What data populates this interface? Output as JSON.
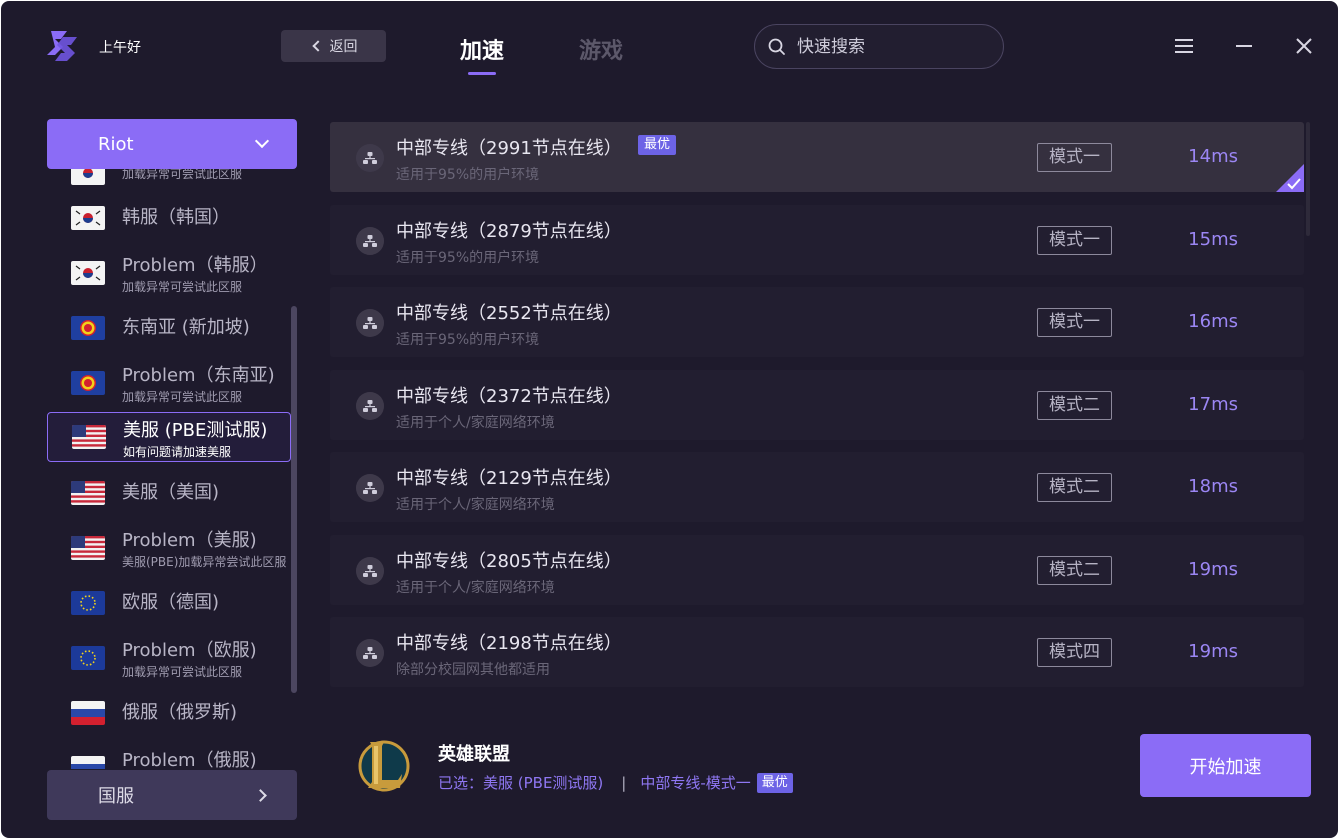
{
  "header": {
    "greeting": "上午好",
    "back_label": "返回",
    "tabs": [
      {
        "label": "加速",
        "active": true
      },
      {
        "label": "游戏",
        "active": false
      }
    ],
    "search_placeholder": "快速搜索"
  },
  "sidebar": {
    "region_label": "Riot",
    "servers": [
      {
        "name": "",
        "sub": "加载异常可尝试此区服",
        "flag": "kr"
      },
      {
        "name": "韩服（韩国）",
        "sub": "",
        "flag": "kr"
      },
      {
        "name": "Problem（韩服）",
        "sub": "加载异常可尝试此区服",
        "flag": "kr"
      },
      {
        "name": "东南亚 (新加坡)",
        "sub": "",
        "flag": "asean"
      },
      {
        "name": "Problem（东南亚)",
        "sub": "加载异常可尝试此区服",
        "flag": "asean"
      },
      {
        "name": "美服 (PBE测试服)",
        "sub": "如有问题请加速美服",
        "flag": "us",
        "selected": true
      },
      {
        "name": "美服（美国)",
        "sub": "",
        "flag": "us"
      },
      {
        "name": "Problem（美服)",
        "sub": "美服(PBE)加载异常尝试此区服",
        "flag": "us"
      },
      {
        "name": "欧服（德国)",
        "sub": "",
        "flag": "eu"
      },
      {
        "name": "Problem（欧服)",
        "sub": "加载异常可尝试此区服",
        "flag": "eu"
      },
      {
        "name": "俄服（俄罗斯)",
        "sub": "",
        "flag": "ru"
      },
      {
        "name": "Problem（俄服)",
        "sub": "",
        "flag": "ru"
      }
    ],
    "bottom_label": "国服"
  },
  "nodes": [
    {
      "title": "中部专线（2991节点在线）",
      "desc": "适用于95%的用户环境",
      "mode": "模式一",
      "latency": "14ms",
      "best": "最优",
      "active": true
    },
    {
      "title": "中部专线（2879节点在线）",
      "desc": "适用于95%的用户环境",
      "mode": "模式一",
      "latency": "15ms"
    },
    {
      "title": "中部专线（2552节点在线）",
      "desc": "适用于95%的用户环境",
      "mode": "模式一",
      "latency": "16ms"
    },
    {
      "title": "中部专线（2372节点在线）",
      "desc": "适用于个人/家庭网络环境",
      "mode": "模式二",
      "latency": "17ms"
    },
    {
      "title": "中部专线（2129节点在线）",
      "desc": "适用于个人/家庭网络环境",
      "mode": "模式二",
      "latency": "18ms"
    },
    {
      "title": "中部专线（2805节点在线）",
      "desc": "适用于个人/家庭网络环境",
      "mode": "模式二",
      "latency": "19ms"
    },
    {
      "title": "中部专线（2198节点在线）",
      "desc": "除部分校园网其他都适用",
      "mode": "模式四",
      "latency": "19ms"
    }
  ],
  "footer": {
    "game_name": "英雄联盟",
    "selected_prefix": "已选：美服 (PBE测试服)",
    "separator": "|",
    "selected_line": "中部专线-模式一",
    "selected_badge": "最优",
    "start_label": "开始加速"
  },
  "colors": {
    "accent": "#8b6cf6",
    "background": "#1e1a2c",
    "latency": "#9b86f3",
    "badge": "#6d63e6"
  }
}
